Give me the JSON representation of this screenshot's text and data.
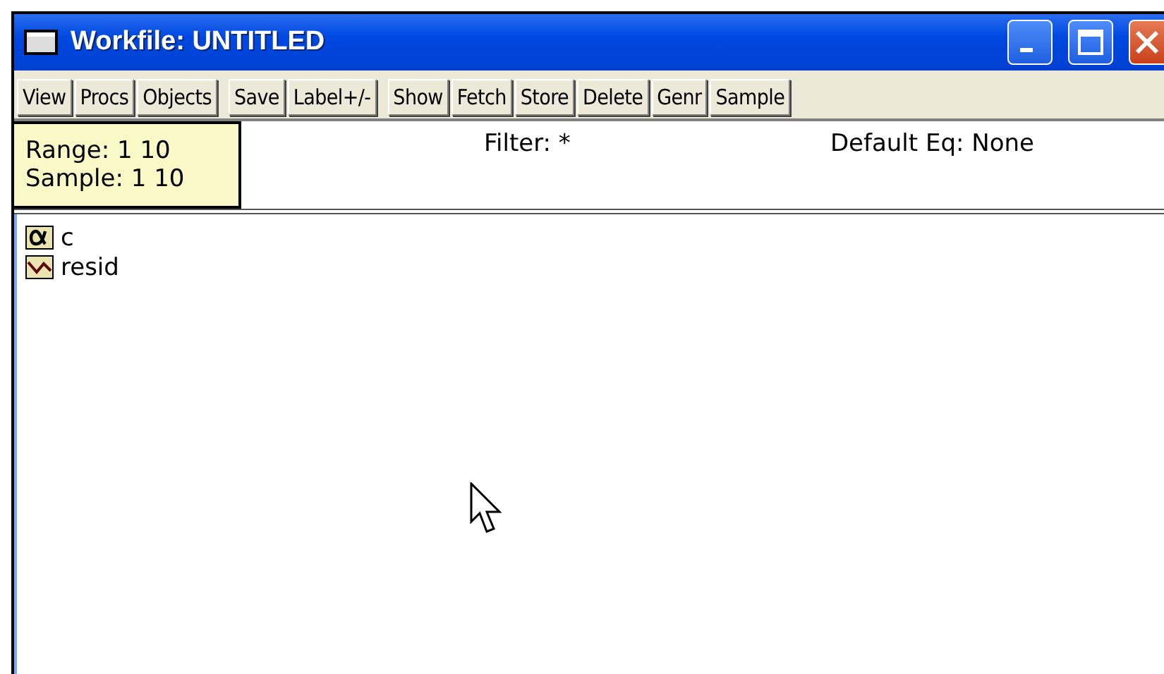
{
  "window": {
    "title": "Workfile: UNTITLED"
  },
  "toolbar": {
    "groups": [
      [
        "View",
        "Procs",
        "Objects"
      ],
      [
        "Save",
        "Label+/-"
      ],
      [
        "Show",
        "Fetch",
        "Store",
        "Delete",
        "Genr",
        "Sample"
      ]
    ]
  },
  "info": {
    "range": "Range:  1 10",
    "sample": "Sample: 1 10",
    "filter": "Filter: *",
    "default_eq": "Default Eq: None"
  },
  "objects": [
    {
      "kind": "coef",
      "name": "c"
    },
    {
      "kind": "series",
      "name": "resid"
    }
  ]
}
